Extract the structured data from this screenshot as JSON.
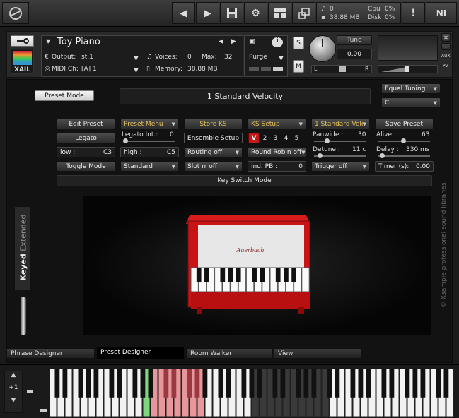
{
  "topbar": {
    "status": {
      "midi_count": "0",
      "memory": "38.88 MB",
      "cpu_label": "Cpu",
      "cpu_value": "0%",
      "disk_label": "Disk",
      "disk_value": "0%"
    },
    "warning_glyph": "!",
    "ni_logo": "NI"
  },
  "instrument": {
    "logo_text": "XAIL",
    "name": "Toy Piano",
    "output_label": "Output:",
    "output_value": "st.1",
    "midi_label": "MIDI Ch:",
    "midi_value": "[A]  1",
    "voices_label": "Voices:",
    "voices_value": "0",
    "max_label": "Max:",
    "max_value": "32",
    "memory_label": "Memory:",
    "memory_value": "38.88 MB",
    "purge_label": "Purge",
    "s_label": "S",
    "m_label": "M",
    "tune_label": "Tune",
    "tune_value": "0.00",
    "pan_left": "L",
    "pan_right": "R",
    "aux_label": "AUX",
    "pv_label": "PV",
    "info_glyph": "i"
  },
  "controls": {
    "preset_mode": "Preset Mode",
    "display_text": "1 Standard Velocity",
    "tuning": "Equal Tuning",
    "tuning_root": "C",
    "row1": {
      "edit_preset": "Edit Preset",
      "preset_menu": "Preset Menu",
      "store_ks": "Store KS",
      "ks_setup": "KS Setup",
      "velocity_menu": "1 Standard Velocity",
      "save_preset": "Save Preset"
    },
    "row2": {
      "legato": "Legato",
      "legato_int_label": "Legato Int.:",
      "legato_int_value": "0",
      "ensemble_setup": "Ensemble Setup",
      "v_button": "V",
      "num_buttons": [
        "2",
        "3",
        "4",
        "5"
      ],
      "panwide_label": "Panwide :",
      "panwide_value": "30",
      "alive_label": "Alive :",
      "alive_value": "63"
    },
    "row3": {
      "low_label": "low :",
      "low_value": "C3",
      "high_label": "high :",
      "high_value": "C5",
      "routing": "Routing off",
      "round_robin": "Round Robin off",
      "detune_label": "Detune :",
      "detune_value": "11 c",
      "delay_label": "Delay :",
      "delay_value": "330 ms"
    },
    "row4": {
      "toggle_mode": "Toggle Mode",
      "standard": "Standard",
      "slot_rr": "Slot rr off",
      "ind_pb_label": "ind. PB :",
      "ind_pb_value": "0",
      "trigger": "Trigger off",
      "timer_label": "Timer (s):",
      "timer_value": "0.00"
    },
    "keyswitch_bar": "Key Switch Mode"
  },
  "side": {
    "keyed": "Keyed",
    "extended": "Extended",
    "copyright": "© Xsample professional sound libraries",
    "piano_brand": "Auerbach"
  },
  "tabs": [
    "Phrase Designer",
    "Preset Designer",
    "Room Walker",
    "View"
  ],
  "keyboard": {
    "octave_label": "+1",
    "white_key_count": 52,
    "keyswitch_white_keys": [
      12
    ],
    "range_white_keys": [
      13,
      14,
      15,
      16,
      17,
      18,
      19
    ],
    "colors": {
      "green": "#7ed67e",
      "red": "#e7979b",
      "accent": "#e6c35a"
    }
  }
}
